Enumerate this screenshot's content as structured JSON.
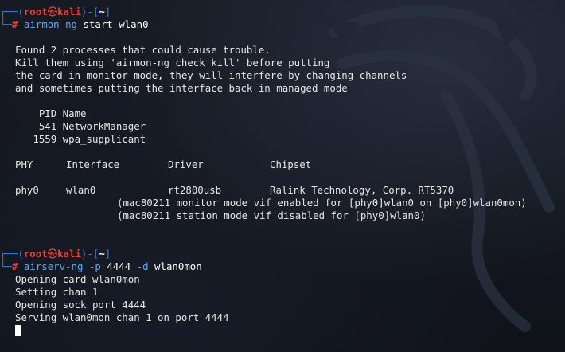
{
  "prompt": {
    "user": "root",
    "skull": "㉿",
    "host": "kali",
    "dir": "~",
    "hash": "#"
  },
  "session1": {
    "cmd": "airmon-ng",
    "args": "start wlan0",
    "warning": [
      "Found 2 processes that could cause trouble.",
      "Kill them using 'airmon-ng check kill' before putting",
      "the card in monitor mode, they will interfere by changing channels",
      "and sometimes putting the interface back in managed mode"
    ],
    "proc_header": "    PID Name",
    "procs": [
      "    541 NetworkManager",
      "   1559 wpa_supplicant"
    ],
    "iface_header": {
      "phy": "PHY",
      "interface": "Interface",
      "driver": "Driver",
      "chipset": "Chipset"
    },
    "iface_row": {
      "phy": "phy0",
      "interface": "wlan0",
      "driver": "rt2800usb",
      "chipset": "Ralink Technology, Corp. RT5370"
    },
    "notes": [
      "(mac80211 monitor mode vif enabled for [phy0]wlan0 on [phy0]wlan0mon)",
      "(mac80211 station mode vif disabled for [phy0]wlan0)"
    ]
  },
  "session2": {
    "cmd": "airserv-ng",
    "flag_p": "-p",
    "port": "4444",
    "flag_d": "-d",
    "iface": "wlan0mon",
    "output": [
      "Opening card wlan0mon",
      "Setting chan 1",
      "Opening sock port 4444",
      "Serving wlan0mon chan 1 on port 4444"
    ]
  }
}
